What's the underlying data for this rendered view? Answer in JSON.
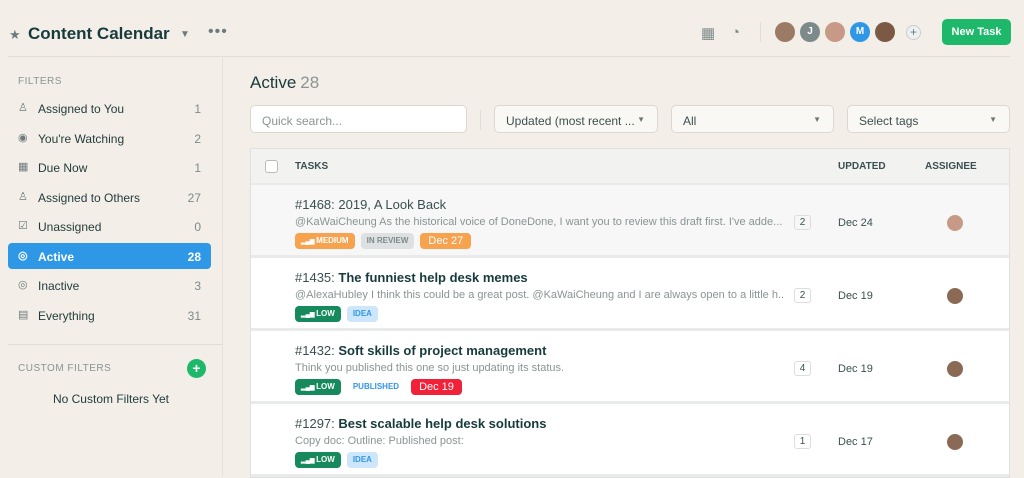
{
  "header": {
    "title": "Content Calendar",
    "more": "•••",
    "new_task": "New Task",
    "avatars": [
      {
        "initial": "",
        "color": "#9b7a66"
      },
      {
        "initial": "J",
        "color": "#7d8a8a"
      },
      {
        "initial": "",
        "color": "#c69a86"
      },
      {
        "initial": "M",
        "color": "#2f98e6"
      },
      {
        "initial": "",
        "color": "#7a5a44"
      }
    ],
    "plus": "+"
  },
  "sidebar": {
    "filters_heading": "FILTERS",
    "items": [
      {
        "label": "Assigned to You",
        "count": "1",
        "icon": "user-icon",
        "glyph": "♙"
      },
      {
        "label": "You're Watching",
        "count": "2",
        "icon": "eye-icon",
        "glyph": "◉"
      },
      {
        "label": "Due Now",
        "count": "1",
        "icon": "calendar-icon",
        "glyph": "▦"
      },
      {
        "label": "Assigned to Others",
        "count": "27",
        "icon": "users-icon",
        "glyph": "♙"
      },
      {
        "label": "Unassigned",
        "count": "0",
        "icon": "checkbox-icon",
        "glyph": "☑"
      },
      {
        "label": "Active",
        "count": "28",
        "icon": "target-icon",
        "glyph": "◎"
      },
      {
        "label": "Inactive",
        "count": "3",
        "icon": "circle-icon",
        "glyph": "◎"
      },
      {
        "label": "Everything",
        "count": "31",
        "icon": "stack-icon",
        "glyph": "▤"
      }
    ],
    "custom_heading": "CUSTOM FILTERS",
    "custom_add": "+",
    "no_custom": "No Custom Filters Yet"
  },
  "main": {
    "title": "Active",
    "count": "28",
    "search_placeholder": "Quick search...",
    "sort": "Updated (most recent ...",
    "status": "All",
    "tags": "Select tags",
    "columns": {
      "tasks": "TASKS",
      "updated": "UPDATED",
      "assignee": "ASSIGNEE"
    },
    "rows": [
      {
        "id": "#1468:",
        "title": "2019, A Look Back",
        "bold": false,
        "desc": "@KaWaiCheung As the historical voice of DoneDone, I want you to review this draft first. I've adde...",
        "tags": [
          {
            "text": "MEDIUM",
            "bg": "#f7a24f",
            "fg": "#fff",
            "bars": true
          },
          {
            "text": "IN REVIEW",
            "bg": "#dde1e2",
            "fg": "#7d8a8a"
          },
          {
            "text": "Dec 27",
            "bg": "#f7a24f",
            "fg": "#fff",
            "date": true
          }
        ],
        "comments": "2",
        "updated": "Dec 24"
      },
      {
        "id": "#1435:",
        "title": "The funniest help desk memes",
        "bold": true,
        "desc": "@AlexaHubley I think this could be a great post.  @KaWaiCheung and I are always open to a little h...",
        "tags": [
          {
            "text": "LOW",
            "bg": "#168a5c",
            "fg": "#fff",
            "bars": true
          },
          {
            "text": "IDEA",
            "bg": "#cde6fb",
            "fg": "#2f98e6"
          }
        ],
        "comments": "2",
        "updated": "Dec 19"
      },
      {
        "id": "#1432:",
        "title": "Soft skills of project management",
        "bold": true,
        "desc": "Think you published this one so just updating its status.",
        "tags": [
          {
            "text": "LOW",
            "bg": "#168a5c",
            "fg": "#fff",
            "bars": true
          },
          {
            "text": "PUBLISHED",
            "bg": "transparent",
            "fg": "#2f98e6"
          },
          {
            "text": "Dec 19",
            "bg": "#f2213a",
            "fg": "#fff",
            "date": true
          }
        ],
        "comments": "4",
        "updated": "Dec 19"
      },
      {
        "id": "#1297:",
        "title": "Best scalable help desk solutions",
        "bold": true,
        "desc": "Copy doc: Outline: Published post:",
        "tags": [
          {
            "text": "LOW",
            "bg": "#168a5c",
            "fg": "#fff",
            "bars": true
          },
          {
            "text": "IDEA",
            "bg": "#cde6fb",
            "fg": "#2f98e6"
          }
        ],
        "comments": "1",
        "updated": "Dec 17"
      }
    ]
  }
}
